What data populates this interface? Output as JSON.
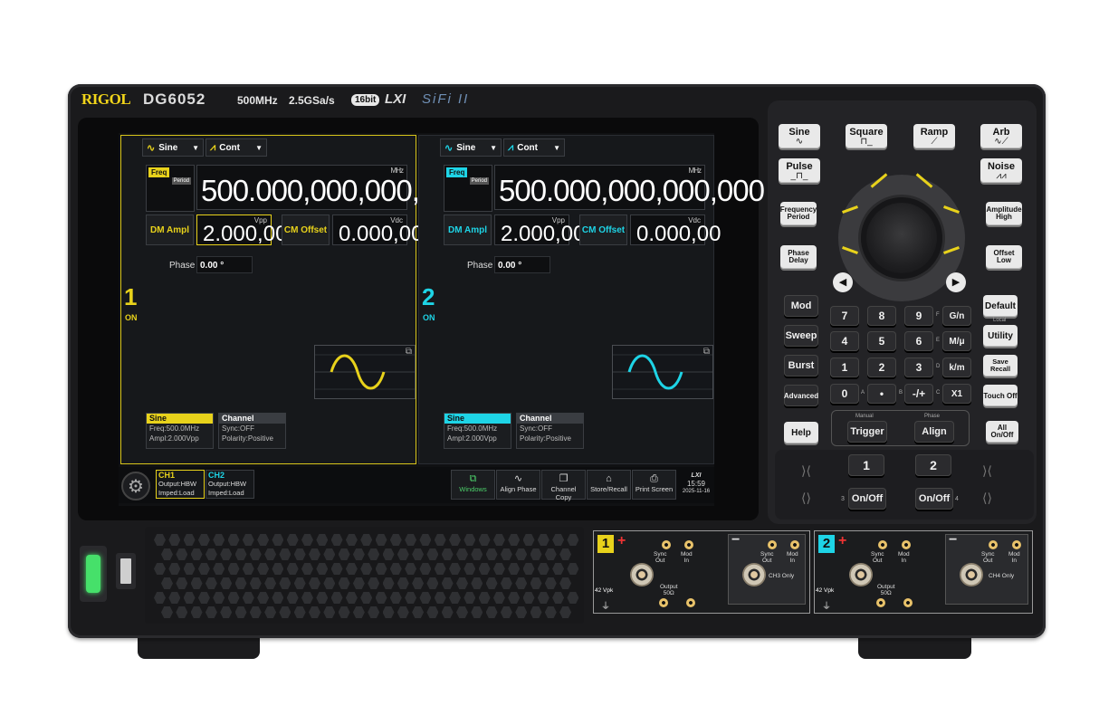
{
  "header": {
    "brand": "RIGOL",
    "model": "DG6052",
    "bandwidth": "500MHz",
    "sample_rate": "2.5GSa/s",
    "bits": "16bit",
    "lxi": "LXI",
    "sifi": "SiFi II"
  },
  "channels": [
    {
      "number": "1",
      "state": "ON",
      "color": "#e8d21b",
      "waveform": "Sine",
      "mode": "Cont",
      "freq_tag": "Freq",
      "period_tag": "Period",
      "frequency": "500.000,000,000,000",
      "freq_unit": "MHz",
      "ampl_label": "DM Ampl",
      "ampl_value": "2.000,00",
      "ampl_unit": "Vpp",
      "offset_label": "CM Offset",
      "offset_value": "0.000,00",
      "offset_unit": "Vdc",
      "phase_label": "Phase",
      "phase_value": "0.00 °",
      "info_wave": "Sine",
      "info_freq": "Freq:500.0MHz",
      "info_ampl": "Ampl:2.000Vpp",
      "info_channel": "Channel",
      "info_sync": "Sync:OFF",
      "info_polarity": "Polarity:Positive"
    },
    {
      "number": "2",
      "state": "ON",
      "color": "#1ed4e6",
      "waveform": "Sine",
      "mode": "Cont",
      "freq_tag": "Freq",
      "period_tag": "Period",
      "frequency": "500.000,000,000,000",
      "freq_unit": "MHz",
      "ampl_label": "DM Ampl",
      "ampl_value": "2.000,00",
      "ampl_unit": "Vpp",
      "offset_label": "CM Offset",
      "offset_value": "0.000,00",
      "offset_unit": "Vdc",
      "phase_label": "Phase",
      "phase_value": "0.00 °",
      "info_wave": "Sine",
      "info_freq": "Freq:500.0MHz",
      "info_ampl": "Ampl:2.000Vpp",
      "info_channel": "Channel",
      "info_sync": "Sync:OFF",
      "info_polarity": "Polarity:Positive"
    }
  ],
  "statusbar": {
    "ch1": {
      "label": "CH1",
      "output": "Output:HBW",
      "imped": "Imped:Load"
    },
    "ch2": {
      "label": "CH2",
      "output": "Output:HBW",
      "imped": "Imped:Load"
    },
    "softkeys": [
      "Windows",
      "Align Phase",
      "Channel Copy",
      "Store/Recall",
      "Print Screen"
    ],
    "lxi_tag": "LXI",
    "time": "15:59",
    "date": "2025-11-16"
  },
  "keys": {
    "waveforms": [
      "Sine",
      "Square",
      "Ramp",
      "Arb",
      "Pulse",
      "Noise"
    ],
    "freq": [
      "Frequency",
      "Period"
    ],
    "phase": [
      "Phase",
      "Delay"
    ],
    "amplitude": [
      "Amplitude",
      "High"
    ],
    "offset": [
      "Offset",
      "Low"
    ],
    "left_column": [
      "Mod",
      "Sweep",
      "Burst",
      "Advanced"
    ],
    "numpad": [
      "7",
      "8",
      "9",
      "4",
      "5",
      "6",
      "1",
      "2",
      "3",
      "0",
      "•",
      "-/+"
    ],
    "numpad_letters": [
      "F",
      "E",
      "D",
      "C",
      "B",
      "A"
    ],
    "units": [
      "G/n",
      "M/μ",
      "k/m",
      "X1"
    ],
    "right_column": [
      "Default",
      "Utility",
      "Save Recall",
      "Touch Off"
    ],
    "local": "Local",
    "help": "Help",
    "manual": "Manual",
    "trigger": "Trigger",
    "phase_sub": "Phase",
    "align": "Align",
    "all_onoff": [
      "All",
      "On/Off"
    ],
    "ch_keys": [
      "1",
      "2"
    ],
    "onoff": "On/Off",
    "small_nums": [
      "3",
      "4"
    ]
  },
  "io": {
    "ch1": "1",
    "ch2": "2",
    "vpk": "42 Vpk",
    "sync_out": [
      "Sync",
      "Out"
    ],
    "mod_in": [
      "Mod",
      "In"
    ],
    "output": "Output",
    "ohm": "50Ω",
    "ch3_only": "CH3 Only",
    "ch4_only": "CH4 Only"
  }
}
